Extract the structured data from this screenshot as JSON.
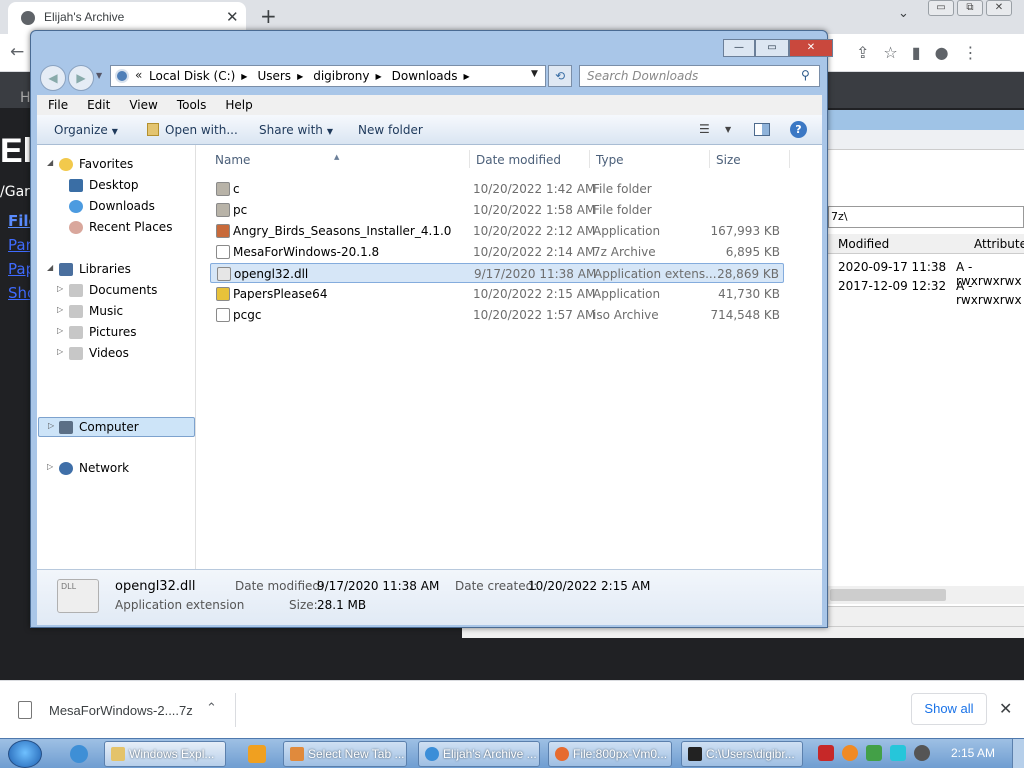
{
  "browser": {
    "tab_title": "Elijah's Archive",
    "tab_close": "✕",
    "new_tab": "+",
    "tab_dropdown": "⌄",
    "back": "←",
    "win_min": "▭",
    "win_max": "⧉",
    "win_close": "✕",
    "page": {
      "nav_letter": "H",
      "heading": "El",
      "crumb": "/Gar",
      "links": [
        "File",
        "Par",
        "Pap",
        "Sho"
      ]
    }
  },
  "background_fm": {
    "path": "7z\\",
    "col_modified": "Modified",
    "col_attributes": "Attributes",
    "rows": [
      {
        "modified": "2020-09-17 11:38",
        "attr": "A -rwxrwxrwx"
      },
      {
        "modified": "2017-12-09 12:32",
        "attr": "A -rwxrwxrwx"
      }
    ]
  },
  "explorer": {
    "caption": {
      "min": "—",
      "max": "▭",
      "close": "✕"
    },
    "address": {
      "prefix": "«",
      "crumbs": [
        "Local Disk (C:)",
        "Users",
        "digibrony",
        "Downloads"
      ]
    },
    "search_placeholder": "Search Downloads",
    "menu": [
      "File",
      "Edit",
      "View",
      "Tools",
      "Help"
    ],
    "commands": {
      "organize": "Organize",
      "open_with": "Open with...",
      "share_with": "Share with",
      "new_folder": "New folder",
      "help": "?"
    },
    "nav": {
      "favorites": "Favorites",
      "desktop": "Desktop",
      "downloads": "Downloads",
      "recent": "Recent Places",
      "libraries": "Libraries",
      "documents": "Documents",
      "music": "Music",
      "pictures": "Pictures",
      "videos": "Videos",
      "computer": "Computer",
      "network": "Network"
    },
    "columns": {
      "name": "Name",
      "date": "Date modified",
      "type": "Type",
      "size": "Size"
    },
    "files": [
      {
        "name": "c",
        "date": "10/20/2022 1:42 AM",
        "type": "File folder",
        "size": "",
        "icon": "folder-icon",
        "color": "#b8b3a8"
      },
      {
        "name": "pc",
        "date": "10/20/2022 1:58 AM",
        "type": "File folder",
        "size": "",
        "icon": "folder-icon",
        "color": "#b8b3a8"
      },
      {
        "name": "Angry_Birds_Seasons_Installer_4.1.0",
        "date": "10/20/2022 2:12 AM",
        "type": "Application",
        "size": "167,993 KB",
        "icon": "installer-icon",
        "color": "#c86a3a"
      },
      {
        "name": "MesaForWindows-20.1.8",
        "date": "10/20/2022 2:14 AM",
        "type": "7z Archive",
        "size": "6,895 KB",
        "icon": "archive-icon",
        "color": "#ffffff"
      },
      {
        "name": "opengl32.dll",
        "date": "9/17/2020 11:38 AM",
        "type": "Application extens...",
        "size": "28,869 KB",
        "icon": "dll-icon",
        "color": "#e6e6e6"
      },
      {
        "name": "PapersPlease64",
        "date": "10/20/2022 2:15 AM",
        "type": "Application",
        "size": "41,730 KB",
        "icon": "app-icon",
        "color": "#e8c23a"
      },
      {
        "name": "pcgc",
        "date": "10/20/2022 1:57 AM",
        "type": "iso Archive",
        "size": "714,548 KB",
        "icon": "iso-icon",
        "color": "#ffffff"
      }
    ],
    "selected_index": 4,
    "details": {
      "dll_label": "DLL",
      "name": "opengl32.dll",
      "type": "Application extension",
      "modified_label": "Date modified:",
      "modified_value": "9/17/2020 11:38 AM",
      "size_label": "Size:",
      "size_value": "28.1 MB",
      "created_label": "Date created:",
      "created_value": "10/20/2022 2:15 AM"
    }
  },
  "downloads_bar": {
    "file": "MesaForWindows-2....7z",
    "show_all": "Show all",
    "chevron": "⌃",
    "close": "✕"
  },
  "taskbar": {
    "buttons": [
      {
        "label": "Windows Expl...",
        "color": "#e4c36a"
      },
      {
        "label": "Select New Tab ...",
        "color": "#e08a3c"
      },
      {
        "label": "Elijah's Archive ...",
        "color": "#3b8ed8"
      },
      {
        "label": "File:800px-Vm0...",
        "color": "#e66b2f"
      },
      {
        "label": "C:\\Users\\digibr...",
        "color": "#222222"
      }
    ],
    "clock": "2:15 AM"
  }
}
